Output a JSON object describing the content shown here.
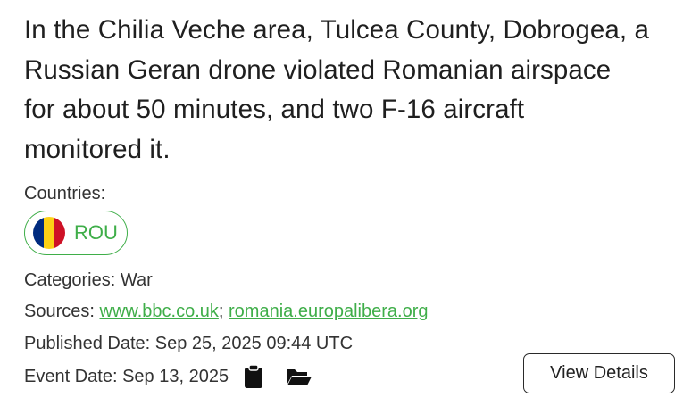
{
  "headline": "In the Chilia Veche area, Tulcea County, Dobrogea, a Russian Geran drone violated Romanian airspace for about 50 minutes, and two F-16 aircraft monitored it.",
  "countries": {
    "label": "Countries:",
    "items": [
      {
        "code": "ROU",
        "flag_colors": [
          "#002B7F",
          "#FCD116",
          "#CE1126"
        ]
      }
    ]
  },
  "categories": {
    "label": "Categories:",
    "value": "War"
  },
  "sources": {
    "label": "Sources:",
    "separator": ";",
    "links": [
      "www.bbc.co.uk",
      "romania.europalibera.org"
    ]
  },
  "published": {
    "label": "Published Date:",
    "value": "Sep 25, 2025 09:44 UTC"
  },
  "event": {
    "label": "Event Date:",
    "value": "Sep 13, 2025",
    "icons": [
      "clipboard-icon",
      "folder-open-icon"
    ]
  },
  "actions": {
    "view_details": "View Details"
  },
  "colors": {
    "accent": "#3fae49",
    "text": "#1f1f1f"
  }
}
